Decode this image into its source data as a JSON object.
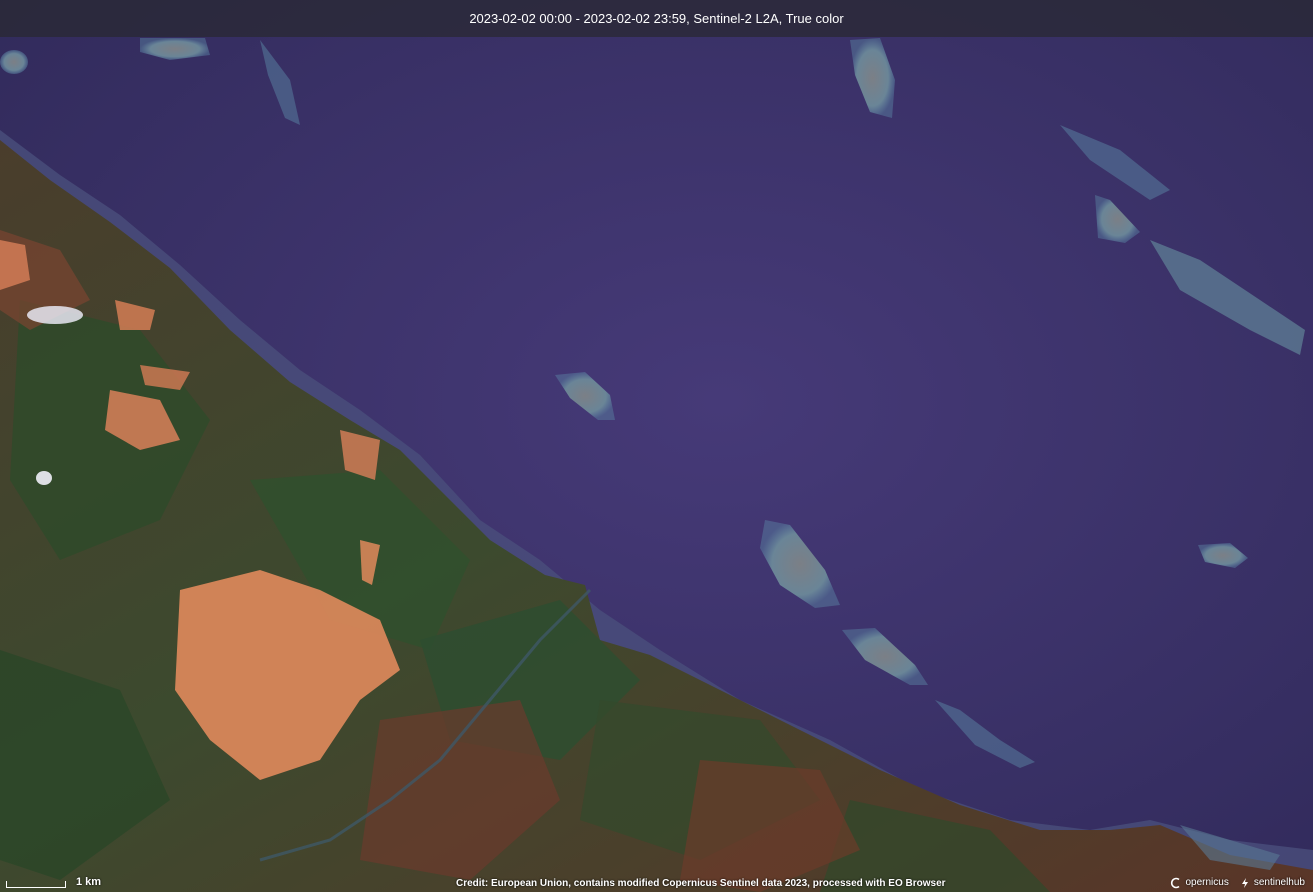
{
  "header": {
    "title": "2023-02-02 00:00 - 2023-02-02 23:59, Sentinel-2 L2A, True color"
  },
  "scale": {
    "label": "1 km"
  },
  "footer": {
    "credit": "Credit: European Union, contains modified Copernicus Sentinel data 2023, processed with EO Browser"
  },
  "logos": {
    "copernicus": "opernicus",
    "sentinelhub": "sentinelhub"
  },
  "colors": {
    "sea": "#3d3468",
    "land_vegetation": "#2e4a2c",
    "mining_area": "#e08a5c",
    "reef": "#6f8a9c"
  }
}
